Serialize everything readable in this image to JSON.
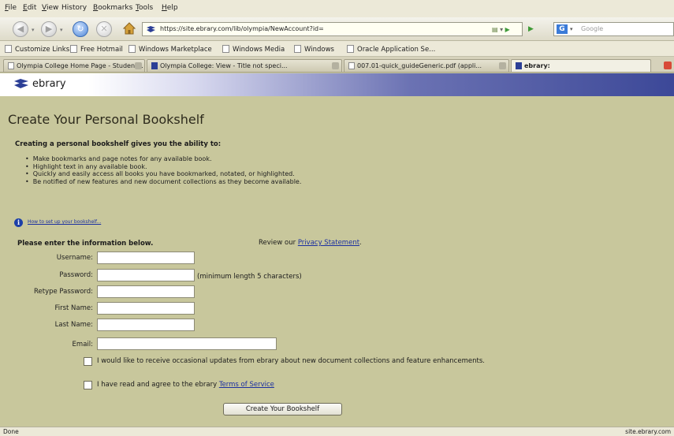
{
  "browser": {
    "menu": [
      {
        "label": "File",
        "u": "F",
        "rest": "ile"
      },
      {
        "label": "Edit",
        "u": "E",
        "rest": "dit"
      },
      {
        "label": "View",
        "u": "V",
        "rest": "iew"
      },
      {
        "label": "History",
        "u": "",
        "rest": "History"
      },
      {
        "label": "Bookmarks",
        "u": "B",
        "rest": "ookmarks"
      },
      {
        "label": "Tools",
        "u": "T",
        "rest": "ools"
      },
      {
        "label": "Help",
        "u": "H",
        "rest": "elp"
      }
    ],
    "url": "https://site.ebrary.com/lib/olympia/NewAccount?id=",
    "search_placeholder": "Google",
    "bookmarks": [
      "Customize Links",
      "Free Hotmail",
      "Windows Marketplace",
      "Windows Media",
      "Windows",
      "Oracle Application Se..."
    ],
    "tabs": [
      {
        "label": "Olympia College Home Page - Student..."
      },
      {
        "label": "Olympia College: View - Title not speci..."
      },
      {
        "label": "007.01-quick_guideGeneric.pdf (appli..."
      },
      {
        "label": "ebrary:"
      }
    ],
    "status_left": "Done",
    "status_right": "site.ebrary.com"
  },
  "header": {
    "logo_text": "ebrary"
  },
  "page": {
    "title": "Create Your Personal Bookshelf",
    "intro": "Creating a personal bookshelf gives you the ability to:",
    "features": [
      "Make bookmarks and page notes for any available book.",
      "Highlight text in any available book.",
      "Quickly and easily access all books you have bookmarked, notated, or highlighted.",
      "Be notified of new features and new document collections as they become available."
    ],
    "howto_link": "How to set up your bookshelf...",
    "enter_info": "Please enter the information below.",
    "review_prefix": "Review our ",
    "privacy_link": "Privacy Statement",
    "review_suffix": "."
  },
  "form": {
    "username_label": "Username:",
    "password_label": "Password:",
    "password_note": "(minimum length 5 characters)",
    "retype_label": "Retype Password:",
    "first_name_label": "First Name:",
    "last_name_label": "Last Name:",
    "email_label": "Email:",
    "username_value": "",
    "password_value": "",
    "retype_value": "",
    "first_name_value": "",
    "last_name_value": "",
    "email_value": "",
    "updates_label": "I would like to receive occasional updates from ebrary about new document collections and feature enhancements.",
    "tos_prefix": "I have read and agree to the ebrary ",
    "tos_link": "Terms of Service",
    "submit_label": "Create Your Bookshelf"
  }
}
